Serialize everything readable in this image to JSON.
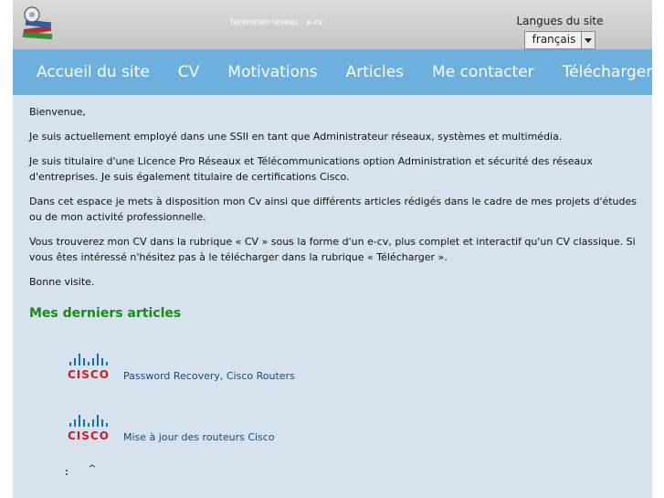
{
  "header": {
    "site_title": "Technicien reseau - e-cv",
    "language_label": "Langues du site",
    "language_selected": "français"
  },
  "nav": {
    "items": [
      "Accueil du site",
      "CV",
      "Motivations",
      "Articles",
      "Me contacter",
      "Télécharger"
    ]
  },
  "content": {
    "greeting": "Bienvenue,",
    "paragraphs": [
      "Je suis actuellement employé dans une SSII en tant que Administrateur réseaux, systèmes et multimédia.",
      "Je suis titulaire d'une Licence Pro Réseaux et Télécommunications option Administration et sécurité des réseaux d'entreprises. Je suis également titulaire de certifications Cisco.",
      "Dans cet espace je mets à disposition mon Cv ainsi que différents articles rédigés dans le cadre de mes projets d'études ou de mon activité professionnelle.",
      "Vous trouverez mon CV dans la rubrique « CV » sous la forme d'un e-cv, plus complet et interactif qu'un CV classique. Si vous êtes intéressé n'hésitez pas à le télécharger dans la rubrique « Télécharger »."
    ],
    "closing": "Bonne visite.",
    "articles_heading": "Mes derniers articles"
  },
  "articles": [
    {
      "logo_text": "CISCO",
      "title": "Password Recovery, Cisco Routers"
    },
    {
      "logo_text": "CISCO",
      "title": "Mise à jour des routeurs Cisco"
    }
  ],
  "icons": {
    "logo": "books-logo-icon",
    "select_arrow": "dropdown-arrow-icon",
    "article_logo": "cisco-logo-icon"
  },
  "colors": {
    "nav_bg": "#6eb0dd",
    "content_bg": "#d6e2ee",
    "heading_green": "#1a8a1a",
    "cisco_red": "#cc1f1f",
    "cisco_blue": "#1f6f9f"
  }
}
